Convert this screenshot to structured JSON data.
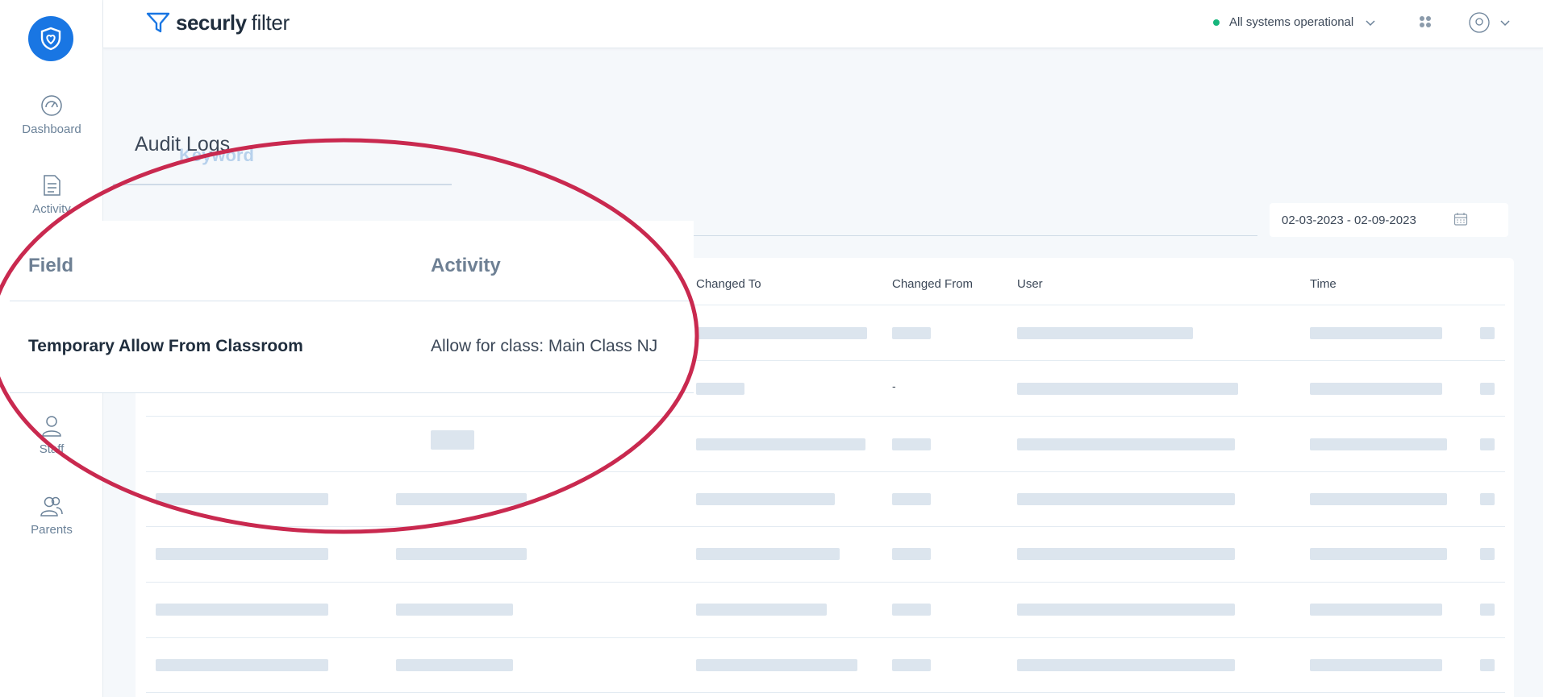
{
  "sidebar": {
    "logo_icon": "shield-heart-icon",
    "items": [
      {
        "label": "Dashboard",
        "icon": "gauge-icon"
      },
      {
        "label": "Activity",
        "icon": "document-icon"
      },
      {
        "label": "Staff",
        "icon": "person-icon"
      },
      {
        "label": "Parents",
        "icon": "people-icon"
      }
    ]
  },
  "header": {
    "brand_primary": "securly",
    "brand_secondary": "filter",
    "status_text": "All systems operational",
    "status_color": "#16b67c"
  },
  "main": {
    "title": "Audit Logs",
    "keyword_ghost": "Keyword",
    "date_range": "02-03-2023 - 02-09-2023",
    "columns": [
      "Changed To",
      "Changed From",
      "User",
      "Time"
    ],
    "visible_changed_from_value": "-"
  },
  "zoom": {
    "col_field": "Field",
    "col_activity": "Activity",
    "row_field": "Temporary Allow From Classroom",
    "row_activity": "Allow for class: Main Class NJ"
  },
  "colors": {
    "brand_blue": "#1976e3",
    "highlight_ellipse": "#c9294f",
    "skeleton": "#dce5ee"
  }
}
